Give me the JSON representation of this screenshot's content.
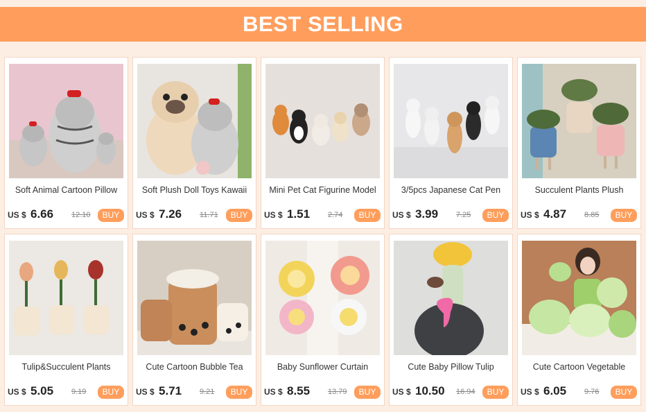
{
  "banner": {
    "title": "BEST SELLING"
  },
  "colors": {
    "accent": "#ff9e5c",
    "background": "#fdeee3"
  },
  "products": [
    {
      "title": "Soft Animal Cartoon Pillow",
      "currency": "US $",
      "price": "6.66",
      "old_price": "12.10",
      "buy_label": "BUY",
      "image": "grey striped cat plush toys with red hats"
    },
    {
      "title": "Soft Plush Doll Toys Kawaii",
      "currency": "US $",
      "price": "7.26",
      "old_price": "11.71",
      "buy_label": "BUY",
      "image": "pug and cat plush dolls"
    },
    {
      "title": "Mini Pet Cat Figurine Model",
      "currency": "US $",
      "price": "1.51",
      "old_price": "2.74",
      "buy_label": "BUY",
      "image": "row of small cat figurines"
    },
    {
      "title": "3/5pcs Japanese Cat Pen",
      "currency": "US $",
      "price": "3.99",
      "old_price": "7.25",
      "buy_label": "BUY",
      "image": "dancing cat pen holders"
    },
    {
      "title": "Succulent Plants Plush",
      "currency": "US $",
      "price": "4.87",
      "old_price": "8.85",
      "buy_label": "BUY",
      "image": "succulent plant plush toys"
    },
    {
      "title": "Tulip&Succulent Plants",
      "currency": "US $",
      "price": "5.05",
      "old_price": "9.19",
      "buy_label": "BUY",
      "image": "tulip plush toys in pots"
    },
    {
      "title": "Cute Cartoon Bubble Tea",
      "currency": "US $",
      "price": "5.71",
      "old_price": "9.21",
      "buy_label": "BUY",
      "image": "bubble tea cup plush pillows"
    },
    {
      "title": "Baby Sunflower Curtain",
      "currency": "US $",
      "price": "8.55",
      "old_price": "13.79",
      "buy_label": "BUY",
      "image": "smiling flower curtain tiebacks"
    },
    {
      "title": "Cute Baby Pillow Tulip",
      "currency": "US $",
      "price": "10.50",
      "old_price": "16.94",
      "buy_label": "BUY",
      "image": "person holding tulip plush pillow"
    },
    {
      "title": "Cute Cartoon Vegetable",
      "currency": "US $",
      "price": "6.05",
      "old_price": "9.76",
      "buy_label": "BUY",
      "image": "girl with cabbage plush toys"
    }
  ]
}
